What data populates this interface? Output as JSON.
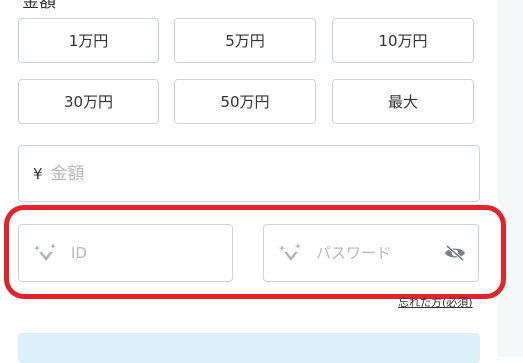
{
  "partial_label": "金額",
  "amount_buttons": [
    "1万円",
    "5万円",
    "10万円",
    "30万円",
    "50万円",
    "最大"
  ],
  "amount_field": {
    "currency_symbol": "¥",
    "placeholder": "金額",
    "value": ""
  },
  "id_field": {
    "placeholder": "ID",
    "value": "",
    "icon": "sparkle-heart-icon"
  },
  "password_field": {
    "placeholder": "パスワード",
    "value": "",
    "icon": "sparkle-heart-icon",
    "toggle_icon": "eye-slash-icon"
  },
  "forgot_link": "忘れた方(必須)",
  "colors": {
    "highlight": "#e1242c",
    "border": "#cfd3d6",
    "placeholder": "#b8b8b8",
    "submit_bg": "#d9f1f7"
  }
}
